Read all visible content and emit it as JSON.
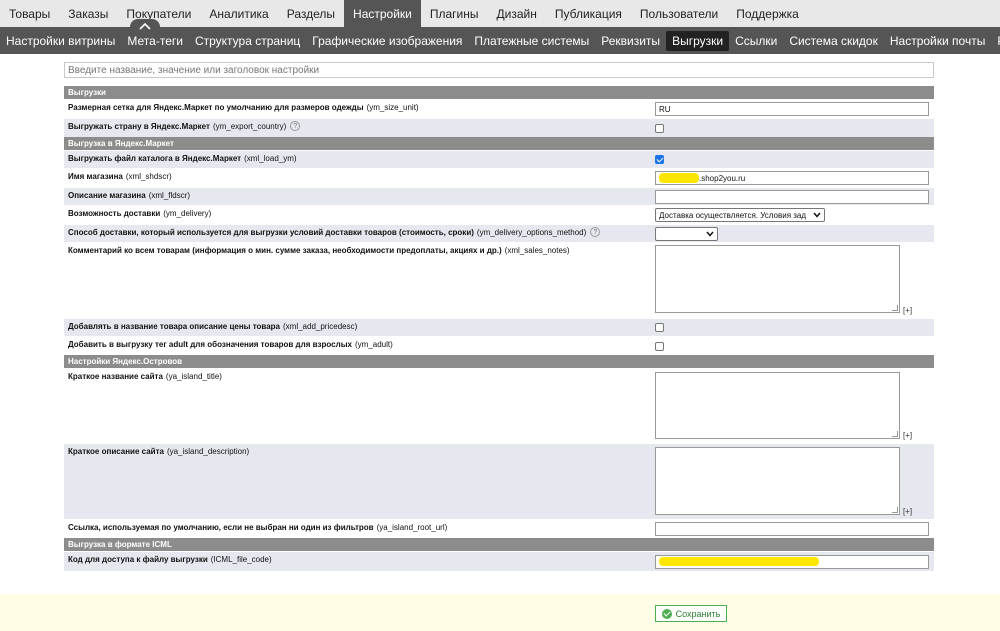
{
  "top_nav": [
    "Товары",
    "Заказы",
    "Покупатели",
    "Аналитика",
    "Разделы",
    "Настройки",
    "Плагины",
    "Дизайн",
    "Публикация",
    "Пользователи",
    "Поддержка"
  ],
  "top_nav_active": 5,
  "sub_nav": [
    "Настройки витрины",
    "Мета-теги",
    "Структура страниц",
    "Графические изображения",
    "Платежные системы",
    "Реквизиты",
    "Выгрузки",
    "Ссылки",
    "Система скидок",
    "Настройки почты",
    "Разделы общения"
  ],
  "sub_nav_active": 6,
  "search": {
    "placeholder": "Введите название, значение или заголовок настройки"
  },
  "sections": {
    "s1": "Выгрузки",
    "s2": "Выгрузка в Яндекс.Маркет",
    "s3": "Настройки Яндекс.Островов",
    "s4": "Выгрузка в формате ICML"
  },
  "rows": {
    "r1": {
      "label": "Размерная сетка для Яндекс.Маркет по умолчанию для размеров одежды",
      "key": "(ym_size_unit)",
      "value": "RU"
    },
    "r2": {
      "label": "Выгружать страну в Яндекс.Маркет",
      "key": "(ym_export_country)",
      "help": "?"
    },
    "r3": {
      "label": "Выгружать файл каталога в Яндекс.Маркет",
      "key": "(xml_load_ym)"
    },
    "r4": {
      "label": "Имя магазина",
      "key": "(xml_shdscr)",
      "value": ".shop2you.ru"
    },
    "r5": {
      "label": "Описание магазина",
      "key": "(xml_fldscr)",
      "value": ""
    },
    "r6": {
      "label": "Возможность доставки",
      "key": "(ym_delivery)",
      "value": "Доставка осуществляется. Условия зад"
    },
    "r7": {
      "label": "Способ доставки, который используется для выгрузки условий доставки товаров (стоимость, сроки)",
      "key": "(ym_delivery_options_method)",
      "help": "?",
      "value": ""
    },
    "r8": {
      "label": "Комментарий ко всем товарам (информация о мин. сумме заказа, необходимости предоплаты, акциях и др.)",
      "key": "(xml_sales_notes)",
      "expand": "[+]"
    },
    "r9": {
      "label": "Добавлять в название товара описание цены товара",
      "key": "(xml_add_pricedesc)"
    },
    "r10": {
      "label": "Добавить в выгрузку тег adult для обозначения товаров для взрослых",
      "key": "(ym_adult)"
    },
    "r11": {
      "label": "Краткое название сайта",
      "key": "(ya_island_title)",
      "expand": "[+]"
    },
    "r12": {
      "label": "Краткое описание сайта",
      "key": "(ya_island_description)",
      "expand": "[+]"
    },
    "r13": {
      "label": "Ссылка, используемая по умолчанию, если не выбран ни один из фильтров",
      "key": "(ya_island_root_url)",
      "value": ""
    },
    "r14": {
      "label": "Код для доступа к файлу выгрузки",
      "key": "(ICML_file_code)",
      "value": ""
    }
  },
  "footer": {
    "save_label": "Сохранить"
  },
  "colors": {
    "nav_active_bg": "#555555",
    "section_bg": "#8c8c8c",
    "row_alt_bg": "#e5e8ef",
    "footer_bg": "#fffde5",
    "save_green": "#4caf50",
    "redaction": "#ffe600"
  }
}
